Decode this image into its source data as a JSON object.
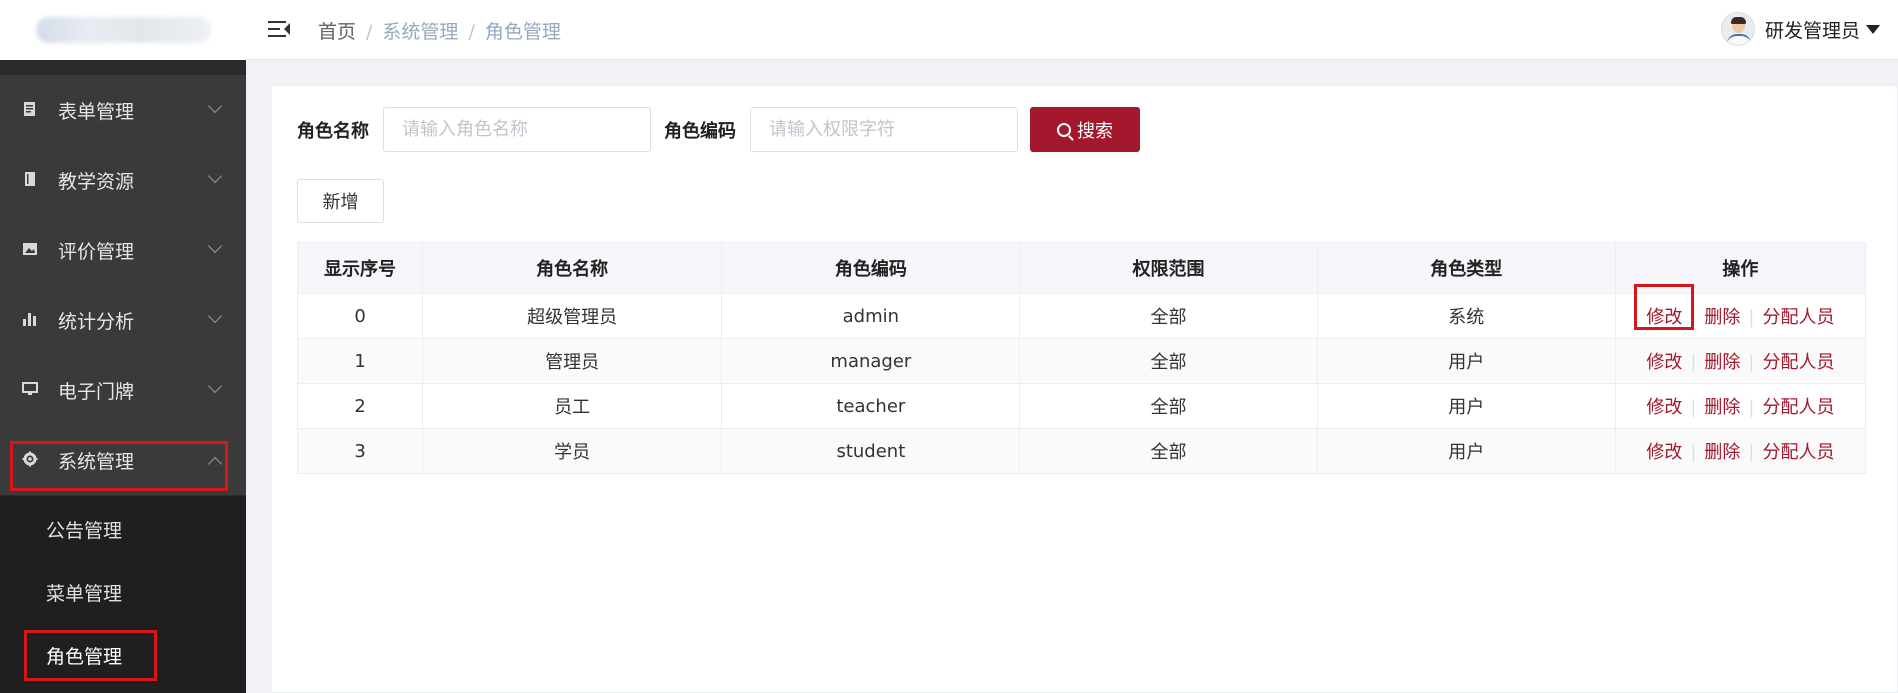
{
  "header": {
    "breadcrumbs": [
      "首页",
      "系统管理",
      "角色管理"
    ],
    "user_name": "研发管理员"
  },
  "sidebar": {
    "items": [
      {
        "label": "表单管理",
        "icon": "form-icon"
      },
      {
        "label": "教学资源",
        "icon": "book-icon"
      },
      {
        "label": "评价管理",
        "icon": "image-icon"
      },
      {
        "label": "统计分析",
        "icon": "bar-chart-icon"
      },
      {
        "label": "电子门牌",
        "icon": "monitor-icon"
      },
      {
        "label": "系统管理",
        "icon": "gear-icon",
        "expanded": true
      }
    ],
    "submenu": [
      "公告管理",
      "菜单管理",
      "角色管理"
    ],
    "active_submenu": "角色管理"
  },
  "filters": {
    "role_name_label": "角色名称",
    "role_name_placeholder": "请输入角色名称",
    "role_code_label": "角色编码",
    "role_code_placeholder": "请输入权限字符",
    "search_label": "搜索"
  },
  "toolbar": {
    "add_label": "新增"
  },
  "table": {
    "headers": [
      "显示序号",
      "角色名称",
      "角色编码",
      "权限范围",
      "角色类型",
      "操作"
    ],
    "rows": [
      {
        "order": "0",
        "name": "超级管理员",
        "code": "admin",
        "scope": "全部",
        "type": "系统"
      },
      {
        "order": "1",
        "name": "管理员",
        "code": "manager",
        "scope": "全部",
        "type": "用户"
      },
      {
        "order": "2",
        "name": "员工",
        "code": "teacher",
        "scope": "全部",
        "type": "用户"
      },
      {
        "order": "3",
        "name": "学员",
        "code": "student",
        "scope": "全部",
        "type": "用户"
      }
    ],
    "actions": {
      "edit": "修改",
      "delete": "删除",
      "assign": "分配人员"
    }
  },
  "colors": {
    "accent": "#a3182c",
    "highlight": "#d6161b",
    "sidebar_bg": "#2b2b2b"
  }
}
